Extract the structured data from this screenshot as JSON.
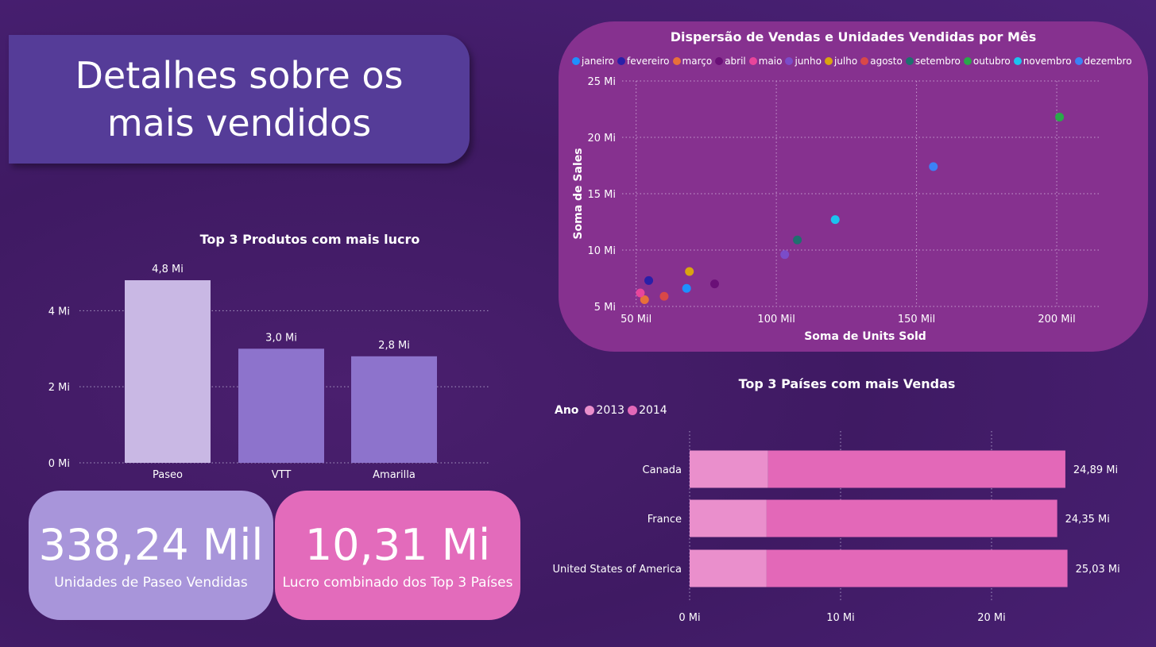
{
  "title": "Detalhes sobre os mais vendidos",
  "colors": {
    "title_card": "#553c98",
    "scatter_card": "#86318f",
    "bar_top": "#c9b8e4",
    "bar": "#8d73cc",
    "kpi_units": "#a895da",
    "kpi_profit": "#e36bbb",
    "y2013": "#ea8fcc",
    "y2014": "#e368b8"
  },
  "bar_chart": {
    "title": "Top 3 Produtos com mais lucro",
    "chart_data": {
      "type": "bar",
      "categories": [
        "Paseo",
        "VTT",
        "Amarilla"
      ],
      "values": [
        4.8,
        3.0,
        2.8
      ],
      "value_labels": [
        "4,8 Mi",
        "3,0 Mi",
        "2,8 Mi"
      ],
      "ylim": [
        0,
        4.8
      ],
      "yticks": [
        0,
        2,
        4
      ],
      "ytick_labels": [
        "0 Mi",
        "2 Mi",
        "4 Mi"
      ],
      "grid": true
    }
  },
  "scatter_chart": {
    "title": "Dispersão de Vendas e Unidades Vendidas por Mês",
    "chart_data": {
      "type": "scatter",
      "xlabel": "Soma de Units Sold",
      "ylabel": "Soma de Sales",
      "xlim": [
        45,
        215
      ],
      "ylim": [
        5,
        25
      ],
      "xticks": [
        50,
        100,
        150,
        200
      ],
      "xtick_labels": [
        "50 Mil",
        "100 Mil",
        "150 Mil",
        "200 Mil"
      ],
      "yticks": [
        5,
        10,
        15,
        20,
        25
      ],
      "ytick_labels": [
        "5 Mi",
        "10 Mi",
        "15 Mi",
        "20 Mi",
        "25 Mi"
      ],
      "grid": true,
      "series": [
        {
          "name": "janeiro",
          "color": "#1e90ff",
          "x": 68,
          "y": 6.6
        },
        {
          "name": "fevereiro",
          "color": "#2a1fa8",
          "x": 54.5,
          "y": 7.3
        },
        {
          "name": "março",
          "color": "#e8703a",
          "x": 53,
          "y": 5.6
        },
        {
          "name": "abril",
          "color": "#6a0f77",
          "x": 78,
          "y": 7.0
        },
        {
          "name": "maio",
          "color": "#e8459b",
          "x": 51.5,
          "y": 6.2
        },
        {
          "name": "junho",
          "color": "#7b4cc9",
          "x": 103,
          "y": 9.6
        },
        {
          "name": "julho",
          "color": "#d9a410",
          "x": 69,
          "y": 8.1
        },
        {
          "name": "agosto",
          "color": "#d94848",
          "x": 60,
          "y": 5.9
        },
        {
          "name": "setembro",
          "color": "#1f6f6f",
          "x": 107.5,
          "y": 10.9
        },
        {
          "name": "outubro",
          "color": "#2aa84a",
          "x": 201,
          "y": 21.8
        },
        {
          "name": "novembro",
          "color": "#1cc2ef",
          "x": 121,
          "y": 12.7
        },
        {
          "name": "dezembro",
          "color": "#3b82f6",
          "x": 156,
          "y": 17.4
        }
      ]
    }
  },
  "country_chart": {
    "title": "Top 3 Países com mais Vendas",
    "legend_title": "Ano",
    "chart_data": {
      "type": "bar",
      "orientation": "horizontal",
      "stacked": true,
      "categories": [
        "Canada",
        "France",
        "United States of America"
      ],
      "series": [
        {
          "name": "2013",
          "values": [
            5.2,
            5.1,
            5.1
          ]
        },
        {
          "name": "2014",
          "values": [
            19.69,
            19.25,
            19.93
          ]
        }
      ],
      "total_labels": [
        "24,89 Mi",
        "24,35 Mi",
        "25,03 Mi"
      ],
      "xlim": [
        0,
        26
      ],
      "xticks": [
        0,
        10,
        20
      ],
      "xtick_labels": [
        "0 Mi",
        "10 Mi",
        "20 Mi"
      ],
      "grid": true
    }
  },
  "kpis": [
    {
      "value": "338,24 Mil",
      "label": "Unidades de Paseo Vendidas"
    },
    {
      "value": "10,31 Mi",
      "label": "Lucro combinado dos Top 3 Países"
    }
  ]
}
